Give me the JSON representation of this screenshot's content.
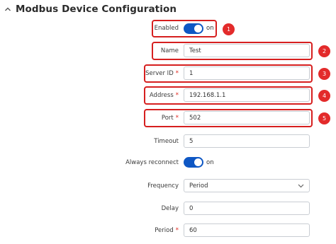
{
  "section": {
    "title": "Modbus Device Configuration"
  },
  "fields": {
    "enabled": {
      "label": "Enabled",
      "state_text": "on"
    },
    "name": {
      "label": "Name",
      "value": "Test"
    },
    "server_id": {
      "label": "Server ID",
      "required": "*",
      "value": "1"
    },
    "address": {
      "label": "Address",
      "required": "*",
      "value": "192.168.1.1"
    },
    "port": {
      "label": "Port",
      "required": "*",
      "value": "502"
    },
    "timeout": {
      "label": "Timeout",
      "value": "5"
    },
    "always_reconnect": {
      "label": "Always reconnect",
      "state_text": "on"
    },
    "frequency": {
      "label": "Frequency",
      "value": "Period"
    },
    "delay": {
      "label": "Delay",
      "value": "0"
    },
    "period": {
      "label": "Period",
      "required": "*",
      "value": "60"
    }
  },
  "annotations": [
    "1",
    "2",
    "3",
    "4",
    "5"
  ],
  "colors": {
    "accent": "#0e57c4",
    "highlight": "#d61f1f",
    "badge": "#e32b2b",
    "required": "#e0241b"
  },
  "icons": {
    "collapse": "chevron-up-icon",
    "dropdown": "chevron-down-icon"
  }
}
